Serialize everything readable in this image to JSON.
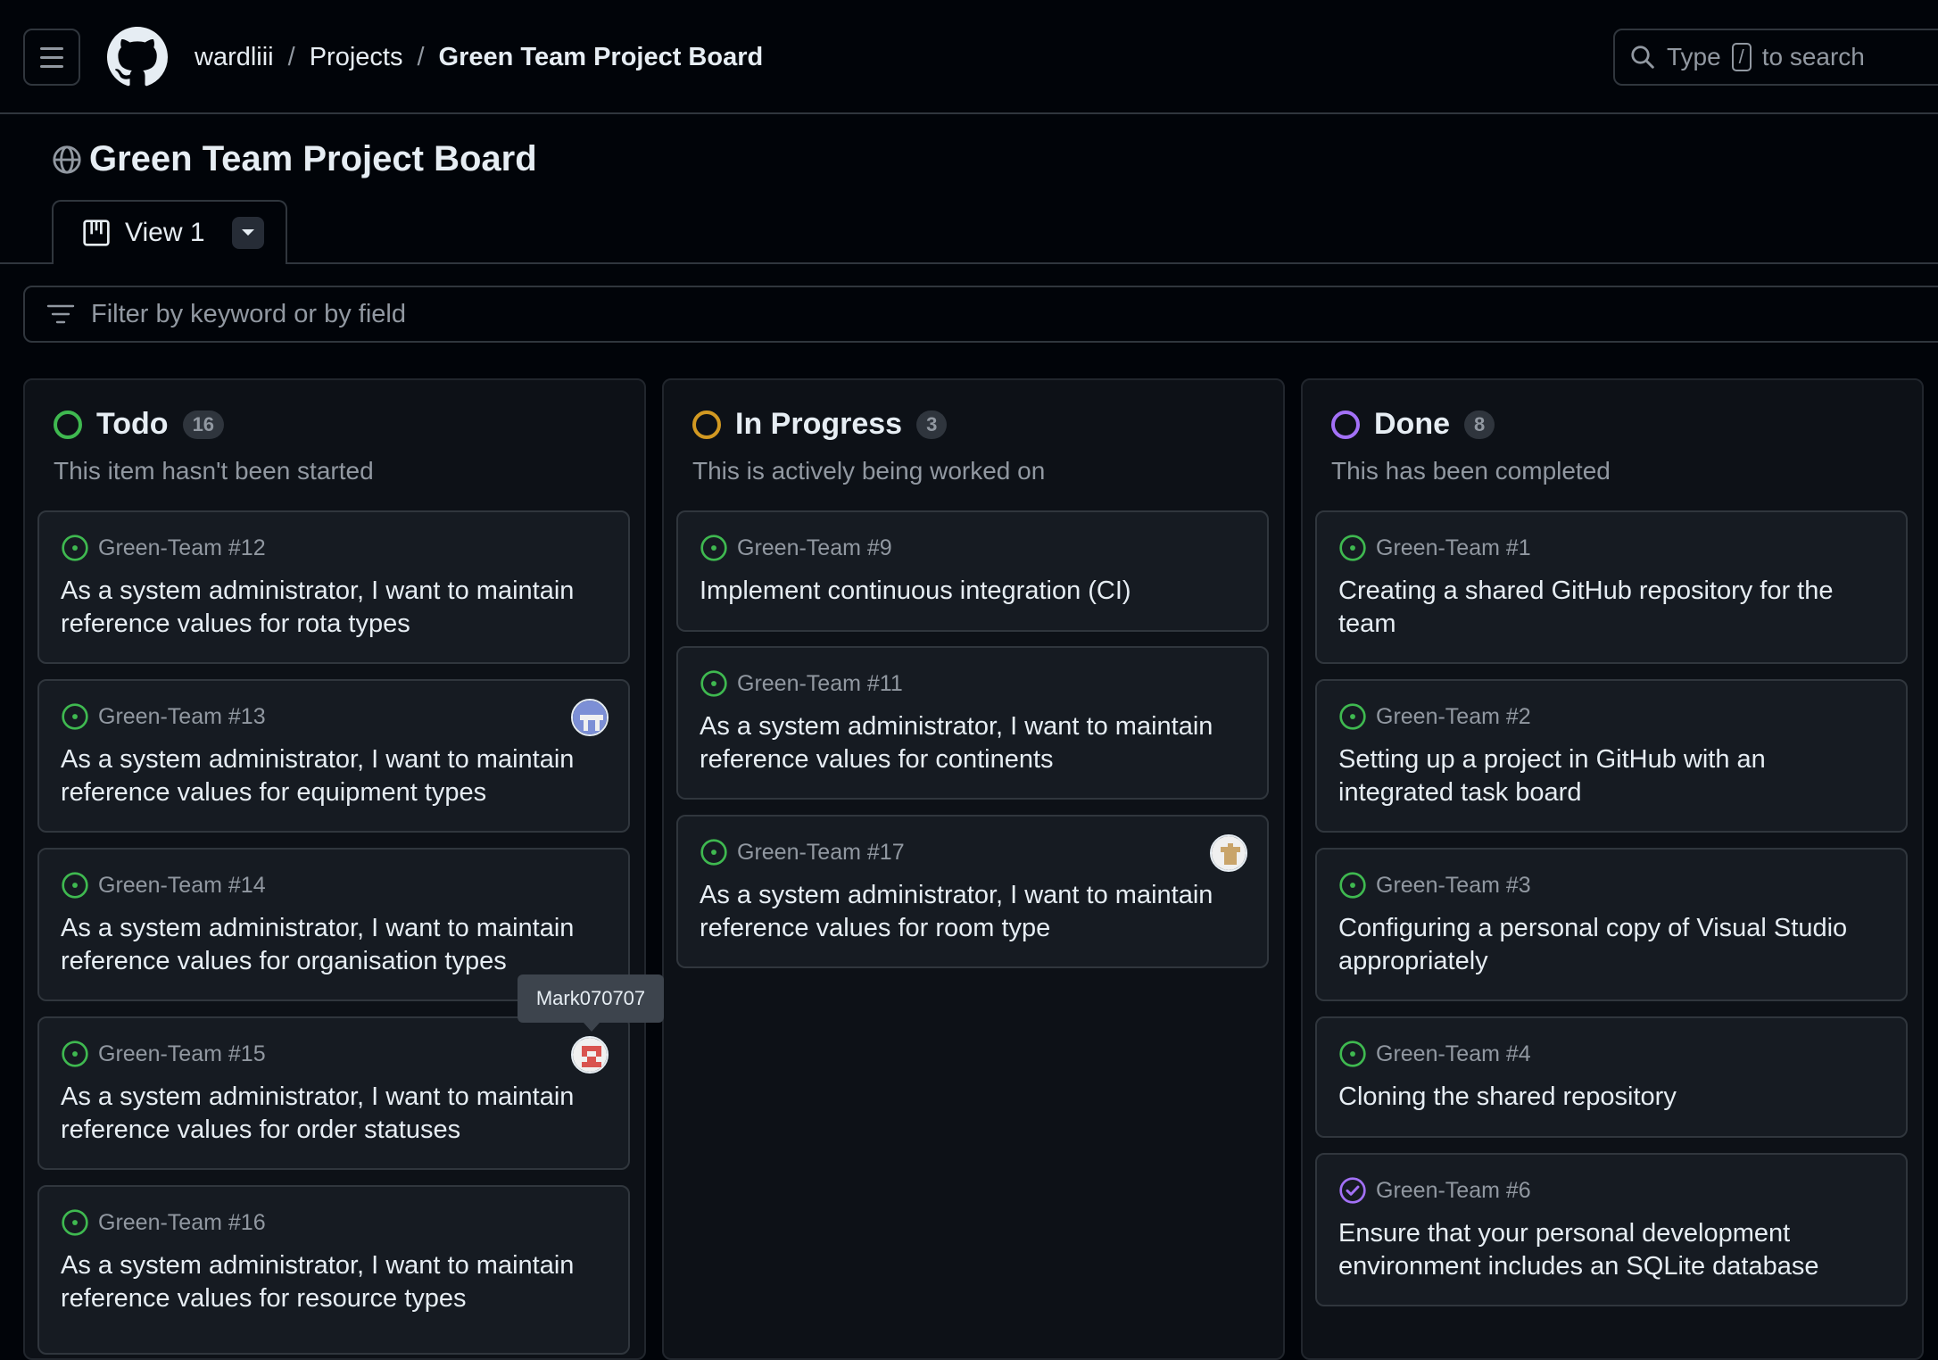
{
  "header": {
    "breadcrumb": {
      "owner": "wardliii",
      "projects": "Projects",
      "board": "Green Team Project Board",
      "separator": "/"
    },
    "search": {
      "prefix": "Type",
      "key": "/",
      "suffix": "to search"
    }
  },
  "project": {
    "title": "Green Team Project Board",
    "view_tab": "View 1"
  },
  "filter": {
    "placeholder": "Filter by keyword or by field"
  },
  "colors": {
    "todo": "#3fb950",
    "in_progress": "#d29922",
    "done": "#a371f7",
    "open_issue": "#3fb950",
    "closed_issue": "#a371f7"
  },
  "columns": [
    {
      "name": "Todo",
      "count": "16",
      "description": "This item hasn't been started",
      "cards": [
        {
          "ref": "Green-Team #12",
          "title": "As a system administrator, I want to maintain reference values for rota types"
        },
        {
          "ref": "Green-Team #13",
          "title": "As a system administrator, I want to maintain reference values for equipment types"
        },
        {
          "ref": "Green-Team #14",
          "title": "As a system administrator, I want to maintain reference values for organisation types"
        },
        {
          "ref": "Green-Team #15",
          "title": "As a system administrator, I want to maintain reference values for order statuses"
        },
        {
          "ref": "Green-Team #16",
          "title": "As a system administrator, I want to maintain reference values for resource types"
        }
      ]
    },
    {
      "name": "In Progress",
      "count": "3",
      "description": "This is actively being worked on",
      "cards": [
        {
          "ref": "Green-Team #9",
          "title": "Implement continuous integration (CI)"
        },
        {
          "ref": "Green-Team #11",
          "title": "As a system administrator, I want to maintain reference values for continents"
        },
        {
          "ref": "Green-Team #17",
          "title": "As a system administrator, I want to maintain reference values for room type"
        }
      ]
    },
    {
      "name": "Done",
      "count": "8",
      "description": "This has been completed",
      "cards": [
        {
          "ref": "Green-Team #1",
          "title": "Creating a shared GitHub repository for the team"
        },
        {
          "ref": "Green-Team #2",
          "title": "Setting up a project in GitHub with an integrated task board"
        },
        {
          "ref": "Green-Team #3",
          "title": "Configuring a personal copy of Visual Studio appropriately"
        },
        {
          "ref": "Green-Team #4",
          "title": "Cloning the shared repository"
        },
        {
          "ref": "Green-Team #6",
          "title": "Ensure that your personal development environment includes an SQLite database"
        }
      ]
    }
  ],
  "tooltip": {
    "text": "Mark070707"
  }
}
